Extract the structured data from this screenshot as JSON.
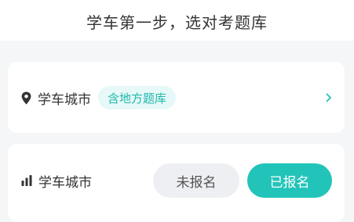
{
  "header": {
    "title": "学车第一步，选对考题库"
  },
  "city_card": {
    "label": "学车城市",
    "badge": "含地方题库",
    "icon": "location-pin-icon",
    "chevron_icon": "chevron-right-icon"
  },
  "status_card": {
    "label": "学车城市",
    "icon": "signal-bars-icon",
    "unregistered_label": "未报名",
    "registered_label": "已报名",
    "selected": "已报名"
  },
  "colors": {
    "accent": "#22c4b9",
    "badge_bg": "#e6f8f7",
    "badge_text": "#1fb8ad",
    "page_bg": "#f5f6f8",
    "unselected_bg": "#eeeff2"
  }
}
